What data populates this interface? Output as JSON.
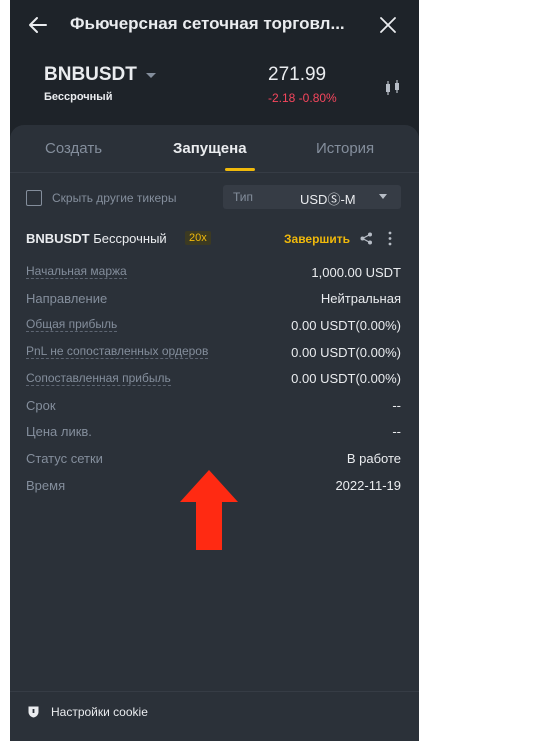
{
  "header": {
    "title": "Фьючерсная сеточная торговл...",
    "back_icon": "arrow-left-icon",
    "close_icon": "close-icon"
  },
  "instrument": {
    "symbol": "BNBUSDT",
    "contract_type": "Бессрочный",
    "price": "271.99",
    "change": "-2.18 -0.80%",
    "chart_icon": "candlestick-chart-icon"
  },
  "tabs": [
    {
      "label": "Создать",
      "active": false
    },
    {
      "label": "Запущена",
      "active": true
    },
    {
      "label": "История",
      "active": false
    }
  ],
  "filters": {
    "hide_others_label": "Скрыть другие тикеры",
    "hide_others_checked": false,
    "type_label": "Тип",
    "type_value": "USDⓈ-M"
  },
  "card": {
    "symbol": "BNBUSDT",
    "contract_type": "Бессрочный",
    "leverage": "20x",
    "finish_label": "Завершить",
    "rows": [
      {
        "label": "Начальная маржа",
        "value": "1,000.00 USDT"
      },
      {
        "label": "Направление",
        "value": "Нейтральная"
      },
      {
        "label": "Общая прибыль",
        "value": "0.00 USDT(0.00%)"
      },
      {
        "label": "PnL не сопоставленных ордеров",
        "value": "0.00 USDT(0.00%)"
      },
      {
        "label": "Сопоставленная прибыль",
        "value": "0.00 USDT(0.00%)"
      },
      {
        "label": "Срок",
        "value": "--"
      },
      {
        "label": "Цена ликв.",
        "value": "--"
      },
      {
        "label": "Статус сетки",
        "value": "В работе"
      },
      {
        "label": "Время",
        "value": "2022-11-19"
      }
    ]
  },
  "footer": {
    "cookie_label": "Настройки cookie",
    "cookie_icon": "shield-icon"
  },
  "colors": {
    "background": "#1e2329",
    "panel": "#2b3139",
    "accent": "#f0b90b",
    "negative": "#f6465d",
    "annotation_arrow": "#ff2a12"
  }
}
